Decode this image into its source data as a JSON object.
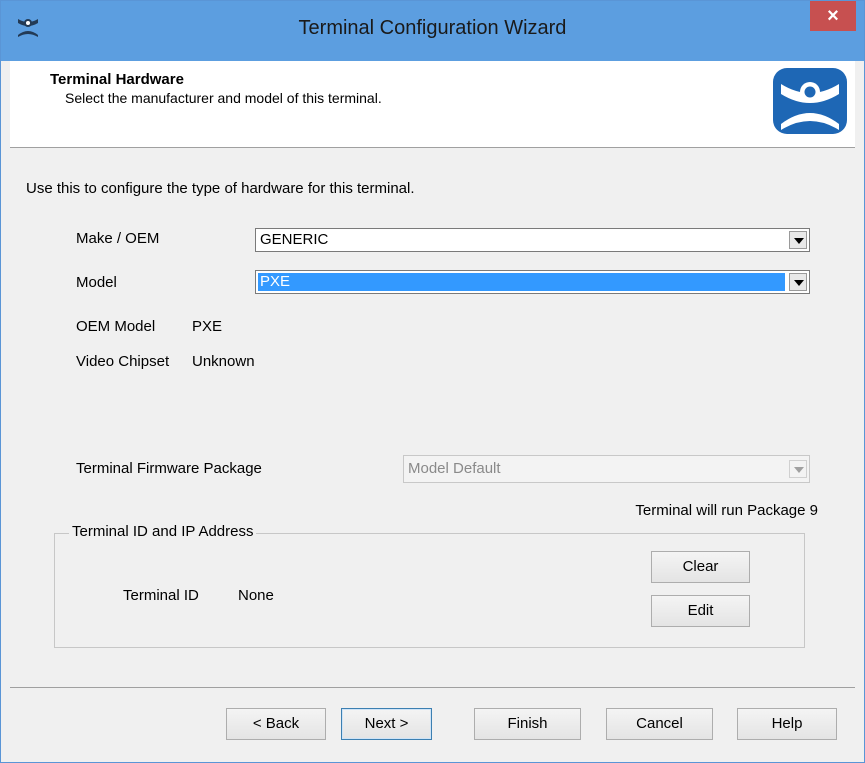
{
  "window": {
    "title": "Terminal Configuration Wizard",
    "close_glyph": "×"
  },
  "header": {
    "title": "Terminal Hardware",
    "subtitle": "Select the manufacturer and model of this terminal."
  },
  "content": {
    "intro": "Use this to configure the type of hardware for this terminal.",
    "make_label": "Make / OEM",
    "make_value": "GENERIC",
    "model_label": "Model",
    "model_value": "PXE",
    "oem_model_label": "OEM Model",
    "oem_model_value": "PXE",
    "video_chipset_label": "Video Chipset",
    "video_chipset_value": "Unknown",
    "firmware_label": "Terminal Firmware Package",
    "firmware_value": "Model Default",
    "firmware_note": "Terminal will run Package 9"
  },
  "group": {
    "label": "Terminal ID and IP Address",
    "terminal_id_label": "Terminal ID",
    "terminal_id_value": "None",
    "clear_label": "Clear",
    "edit_label": "Edit"
  },
  "footer": {
    "back_label": "< Back",
    "next_label": "Next >",
    "finish_label": "Finish",
    "cancel_label": "Cancel",
    "help_label": "Help"
  },
  "icons": {
    "app": "terminal-services-icon",
    "logo": "terminal-services-logo",
    "close": "close-icon",
    "dropdown": "chevron-down-icon"
  },
  "colors": {
    "titlebar": "#5c9ee0",
    "close": "#c75050",
    "selection": "#3399ff",
    "logo": "#1e67b5"
  }
}
